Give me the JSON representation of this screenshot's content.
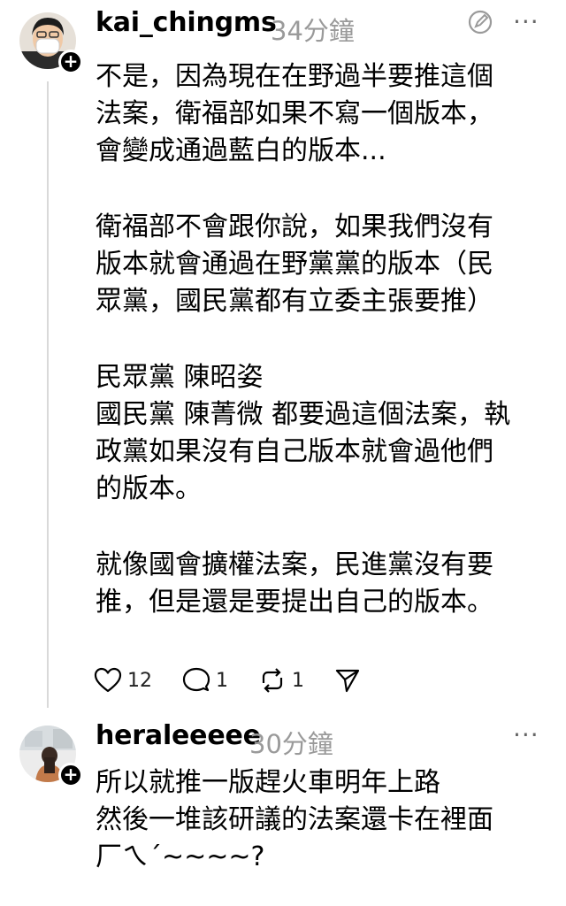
{
  "posts": [
    {
      "username": "kai_chingms",
      "time": "34分鐘",
      "paragraphs": [
        "不是，因為現在在野過半要推這個\n法案，衛福部如果不寫一個版本，\n會變成通過藍白的版本...",
        "衛福部不會跟你說，如果我們沒有\n版本就會通過在野黨黨的版本（民\n眾黨，國民黨都有立委主張要推）",
        "民眾黨 陳昭姿\n國民黨 陳菁微 都要過這個法案，執\n政黨如果沒有自己版本就會過他們\n的版本。",
        "就像國會擴權法案，民進黨沒有要\n推，但是還是要提出自己的版本。"
      ],
      "likes": "12",
      "replies": "1",
      "reposts": "1",
      "icons": [
        "edit-icon",
        "more-icon",
        "heart-icon",
        "comment-icon",
        "repost-icon",
        "share-icon"
      ]
    },
    {
      "username": "heraleeeee",
      "time": "30分鐘",
      "text": "所以就推一版趕火車明年上路\n然後一堆該研議的法案還卡在裡面\n厂ㄟˊ~~~~?",
      "icons": [
        "more-icon"
      ]
    }
  ],
  "badge_symbol": "+",
  "more_symbol": "···"
}
